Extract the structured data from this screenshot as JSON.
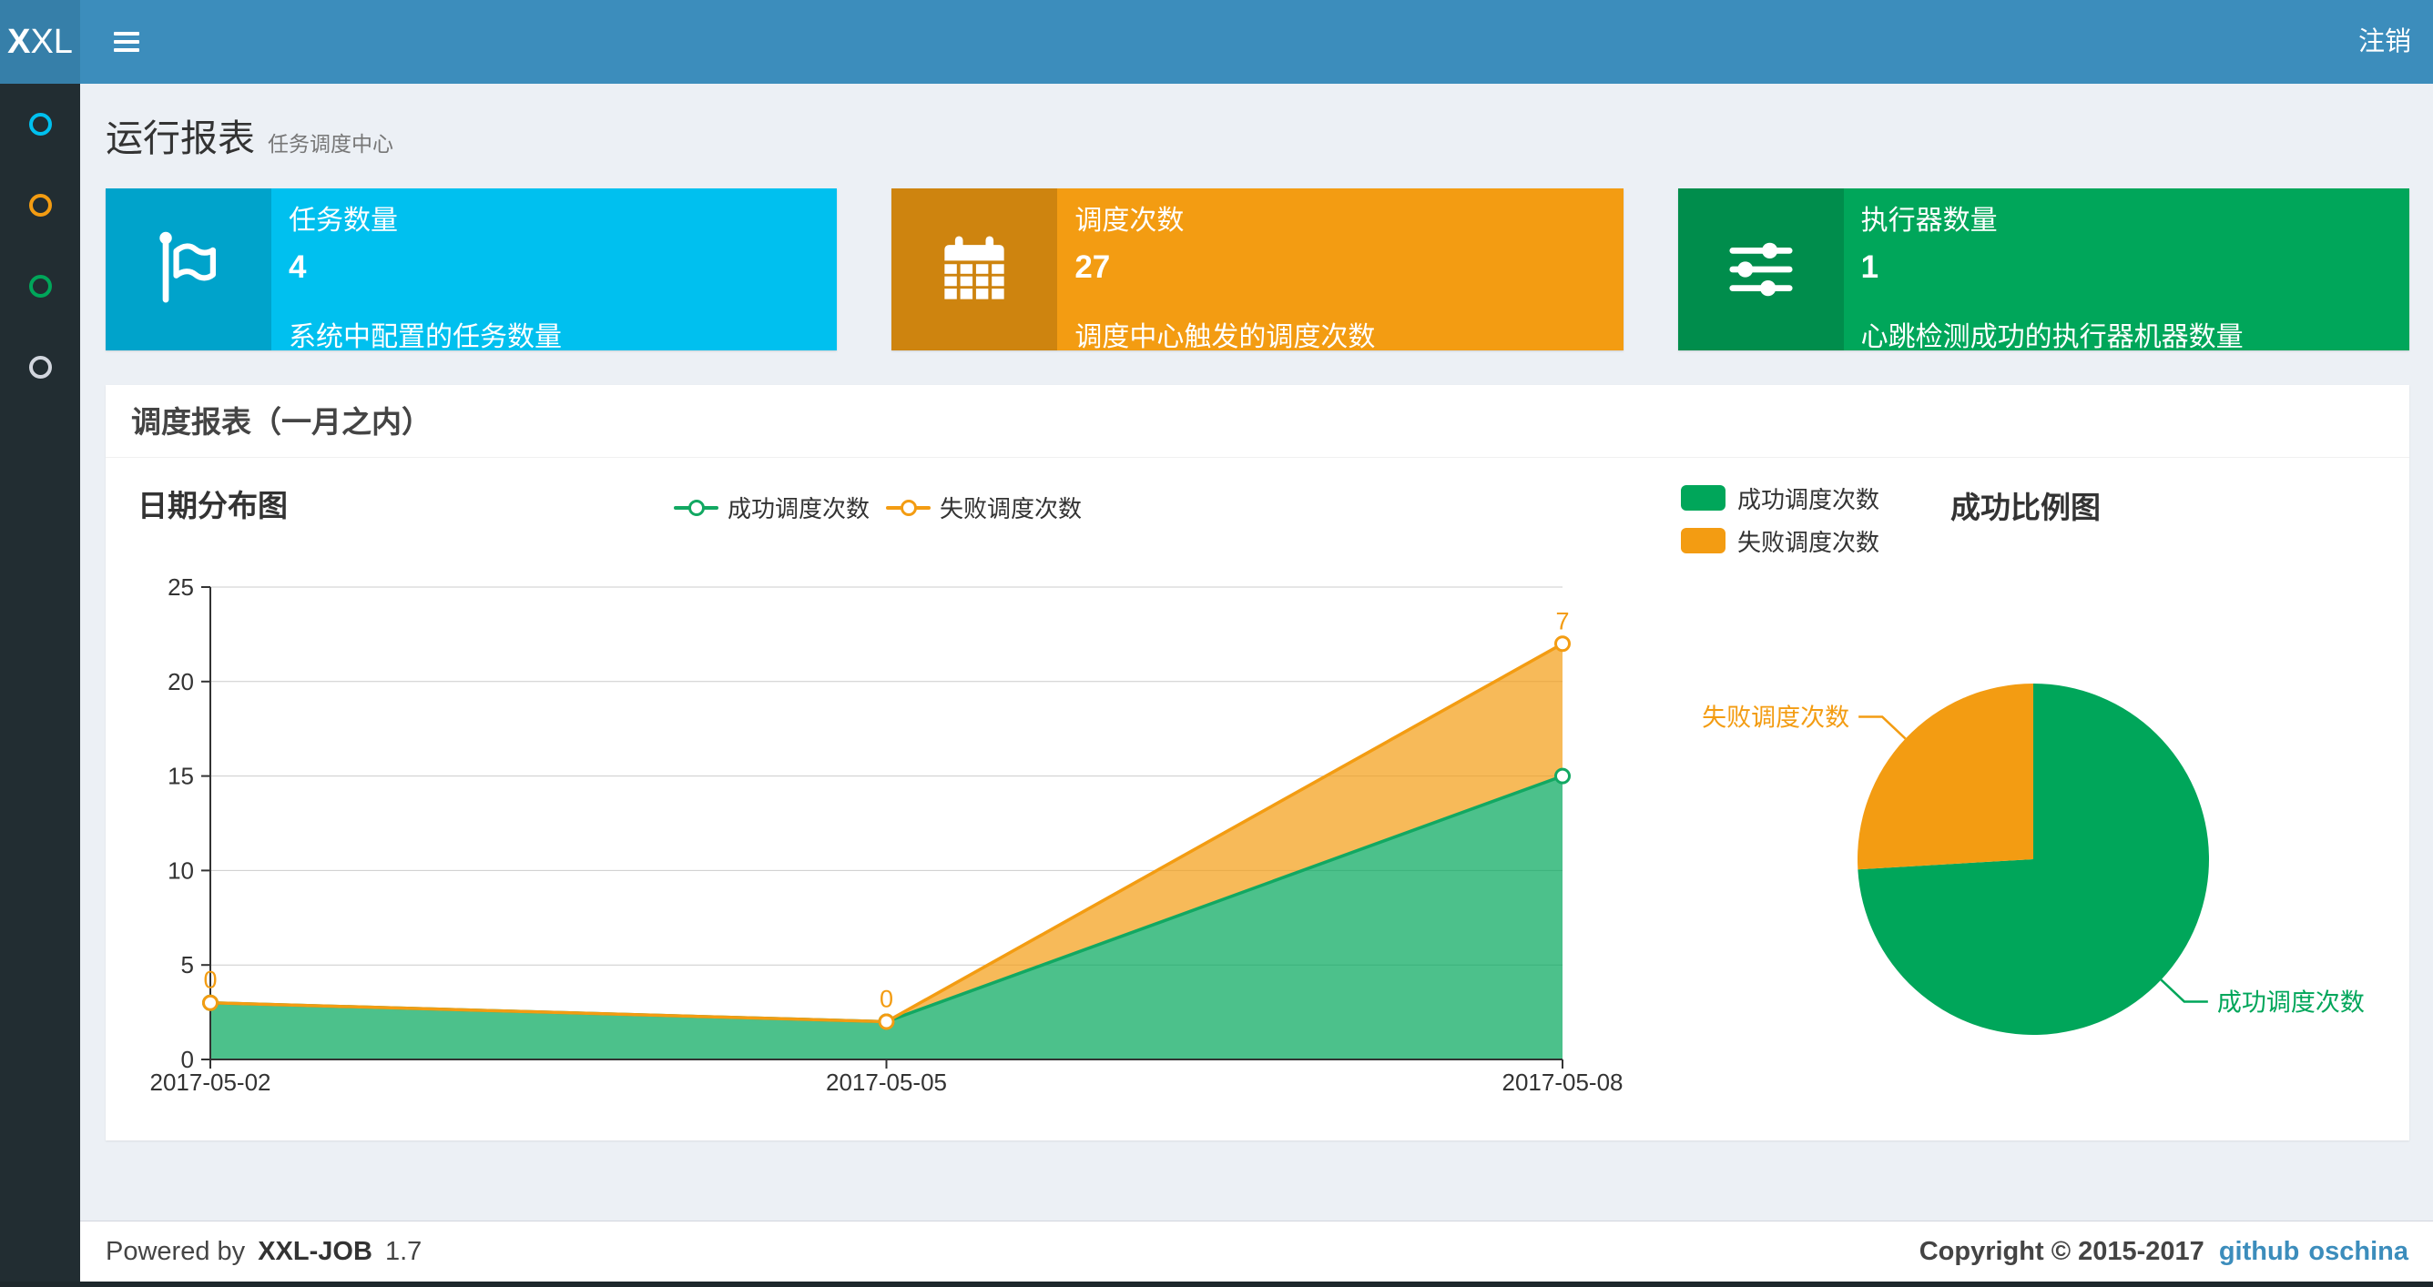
{
  "navbar": {
    "logo_bold": "X",
    "logo_rest": "XL",
    "logout_label": "注销"
  },
  "sidebar": {
    "items": [
      {
        "name": "menu-reports",
        "color": "#00c0ef"
      },
      {
        "name": "menu-jobs",
        "color": "#f39c12"
      },
      {
        "name": "menu-executors",
        "color": "#00a65a"
      },
      {
        "name": "menu-help",
        "color": "#d2d6de"
      }
    ]
  },
  "page_header": {
    "title": "运行报表",
    "subtitle": "任务调度中心"
  },
  "info_boxes": [
    {
      "label": "任务数量",
      "value": "4",
      "description": "系统中配置的任务数量",
      "bg": "#00c0ef",
      "icon": "flag-icon"
    },
    {
      "label": "调度次数",
      "value": "27",
      "description": "调度中心触发的调度次数",
      "bg": "#f39c12",
      "icon": "calendar-icon"
    },
    {
      "label": "执行器数量",
      "value": "1",
      "description": "心跳检测成功的执行器机器数量",
      "bg": "#00a65a",
      "icon": "sliders-icon"
    }
  ],
  "panel": {
    "title": "调度报表（一月之内）"
  },
  "chart_data": [
    {
      "type": "area",
      "title": "日期分布图",
      "x": [
        "2017-05-02",
        "2017-05-05",
        "2017-05-08"
      ],
      "series": [
        {
          "name": "成功调度次数",
          "values": [
            3,
            2,
            15
          ],
          "color": "#12a862",
          "fill": "rgba(0,166,90,0.7)"
        },
        {
          "name": "失败调度次数",
          "values": [
            0,
            0,
            7
          ],
          "color": "#f39c12",
          "fill": "rgba(243,156,18,0.7)",
          "point_labels": [
            "0",
            "0",
            "7"
          ]
        }
      ],
      "stacked": true,
      "ylim": [
        0,
        25
      ],
      "yticks": [
        0,
        5,
        10,
        15,
        20,
        25
      ],
      "grid": true,
      "legend_position": "top"
    },
    {
      "type": "pie",
      "title": "成功比例图",
      "slices": [
        {
          "name": "成功调度次数",
          "value": 20,
          "color": "#00a65a"
        },
        {
          "name": "失败调度次数",
          "value": 7,
          "color": "#f39c12"
        }
      ],
      "legend_position": "top-left"
    }
  ],
  "footer": {
    "powered_prefix": "Powered by",
    "product": "XXL-JOB",
    "version": "1.7",
    "copyright": "Copyright © 2015-2017",
    "links": [
      "github",
      "oschina"
    ]
  }
}
